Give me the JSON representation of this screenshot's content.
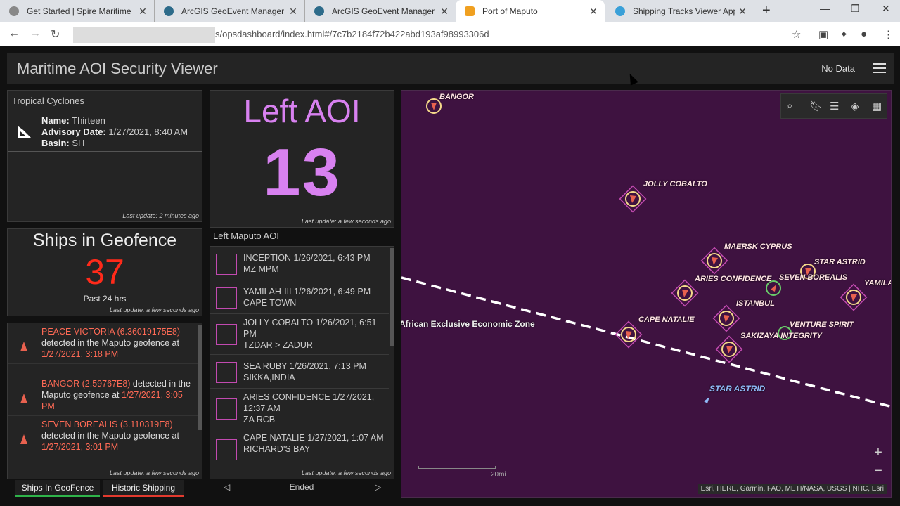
{
  "browser": {
    "tabs": [
      {
        "title": "Get Started | Spire Maritime"
      },
      {
        "title": "ArcGIS GeoEvent Manager"
      },
      {
        "title": "ArcGIS GeoEvent Manager"
      },
      {
        "title": "Port of Maputo"
      },
      {
        "title": "Shipping Tracks Viewer Applic"
      }
    ],
    "url_path": "s/opsdashboard/index.html#/7c7b2184f72b422abd193af98993306d"
  },
  "header": {
    "title": "Maritime AOI Security Viewer",
    "status": "No Data"
  },
  "cyclones": {
    "title": "Tropical Cyclones",
    "name_label": "Name:",
    "name": "Thirteen",
    "advisory_label": "Advisory Date:",
    "advisory": "1/27/2021, 8:40 AM",
    "basin_label": "Basin:",
    "basin": "SH",
    "last_update": "Last update: 2 minutes ago"
  },
  "geofence": {
    "title": "Ships in Geofence",
    "count": "37",
    "period": "Past 24 hrs",
    "last_update": "Last update: a few seconds ago"
  },
  "alerts": {
    "items": [
      {
        "ship": "PEACE VICTORIA (6.36019175E8)",
        "mid": " detected in the Maputo geofence at ",
        "time": "1/27/2021, 3:18 PM"
      },
      {
        "ship": "BANGOR (2.59767E8)",
        "mid": " detected in the Maputo geofence at ",
        "time": "1/27/2021, 3:05 PM"
      },
      {
        "ship": "SEVEN BOREALIS (3.110319E8)",
        "mid": " detected in the Maputo geofence at ",
        "time": "1/27/2021, 3:01 PM"
      }
    ],
    "last_update": "Last update: a few seconds ago"
  },
  "bottom_tabs": {
    "ships": "Ships In GeoFence",
    "historic": "Historic Shipping"
  },
  "aoi": {
    "title": "Left AOI",
    "count": "13",
    "last_update": "Last update: a few seconds ago"
  },
  "maputo_list": {
    "title": "Left Maputo AOI",
    "items": [
      {
        "line1": "INCEPTION 1/26/2021, 6:43 PM",
        "line2": "MZ MPM"
      },
      {
        "line1": "YAMILAH-III 1/26/2021, 6:49 PM",
        "line2": "CAPE TOWN"
      },
      {
        "line1": "JOLLY COBALTO 1/26/2021, 6:51 PM",
        "line2": "TZDAR > ZADUR"
      },
      {
        "line1": "SEA RUBY 1/26/2021, 7:13 PM",
        "line2": "SIKKA,INDIA"
      },
      {
        "line1": "ARIES CONFIDENCE 1/27/2021, 12:37 AM",
        "line2": "ZA RCB"
      },
      {
        "line1": "CAPE NATALIE 1/27/2021, 1:07 AM",
        "line2": "RICHARD'S BAY"
      }
    ],
    "last_update": "Last update: a few seconds ago",
    "pager_label": "Ended"
  },
  "map": {
    "labels": {
      "bangor": "BANGOR",
      "jolly": "JOLLY COBALTO",
      "maersk": "MAERSK CYPRUS",
      "star_astrid": "STAR ASTRID",
      "aries": "ARIES CONFIDENCE",
      "seven": "SEVEN BOREALIS",
      "yamila": "YAMILA",
      "istanbul": "ISTANBUL",
      "cape_natalie": "CAPE NATALIE",
      "venture": "VENTURE SPIRIT",
      "sakizaya": "SAKIZAYA INTEGRITY",
      "star_astrid_2": "STAR ASTRID",
      "eez": "African Exclusive Economic Zone"
    },
    "scale": "20mi",
    "attribution": "Esri, HERE, Garmin, FAO, METI/NASA, USGS | NHC, Esri",
    "colors": {
      "background": "#3e1240",
      "ship_ring": "#f5d98a",
      "geofence": "#c24ab0"
    }
  }
}
